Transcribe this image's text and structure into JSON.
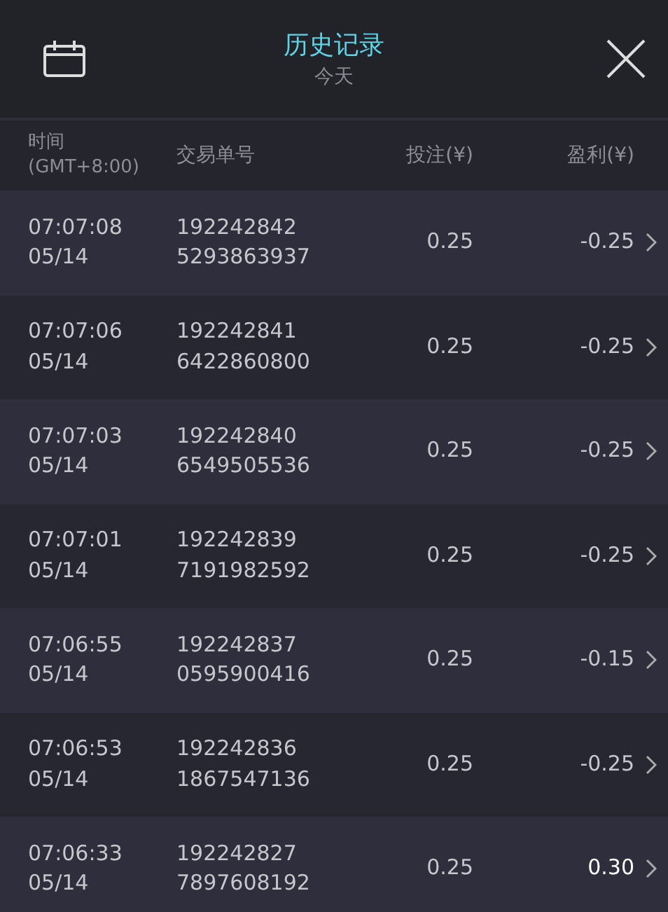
{
  "header": {
    "title": "历史记录",
    "subtitle": "今天"
  },
  "table": {
    "columns": [
      "时间\n(GMT+8:00)",
      "交易单号",
      "投注(¥)",
      "盈利(¥)"
    ],
    "rows": [
      {
        "time": "07:07:08",
        "date": "05/14",
        "id_1": "192242842",
        "id_2": "5293863937",
        "stake": "0.25",
        "profit": "-0.25",
        "win": false
      },
      {
        "time": "07:07:06",
        "date": "05/14",
        "id_1": "192242841",
        "id_2": "6422860800",
        "stake": "0.25",
        "profit": "-0.25",
        "win": false
      },
      {
        "time": "07:07:03",
        "date": "05/14",
        "id_1": "192242840",
        "id_2": "6549505536",
        "stake": "0.25",
        "profit": "-0.25",
        "win": false
      },
      {
        "time": "07:07:01",
        "date": "05/14",
        "id_1": "192242839",
        "id_2": "7191982592",
        "stake": "0.25",
        "profit": "-0.25",
        "win": false
      },
      {
        "time": "07:06:55",
        "date": "05/14",
        "id_1": "192242837",
        "id_2": "0595900416",
        "stake": "0.25",
        "profit": "-0.15",
        "win": false
      },
      {
        "time": "07:06:53",
        "date": "05/14",
        "id_1": "192242836",
        "id_2": "1867547136",
        "stake": "0.25",
        "profit": "-0.25",
        "win": false
      },
      {
        "time": "07:06:33",
        "date": "05/14",
        "id_1": "192242827",
        "id_2": "7897608192",
        "stake": "0.25",
        "profit": "0.30",
        "win": true
      }
    ]
  }
}
